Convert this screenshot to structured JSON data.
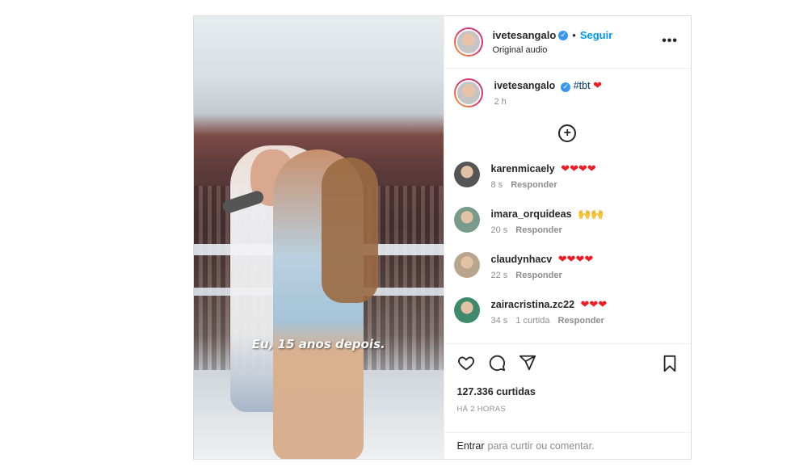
{
  "post": {
    "username": "ivetesangalo",
    "verified_mark": "✓",
    "separator": "•",
    "follow_label": "Seguir",
    "audio_label": "Original audio",
    "more_label": "•••",
    "video_caption": "Eu, 15 anos depois."
  },
  "caption": {
    "username": "ivetesangalo",
    "text": "#tbt",
    "emoji": "❤",
    "time": "2 h"
  },
  "load_more_label": "+",
  "comments": [
    {
      "username": "karenmicaely",
      "text": "❤❤❤❤",
      "time": "8 s",
      "likes": "",
      "reply": "Responder",
      "avatar_color": "#555555"
    },
    {
      "username": "imara_orquideas",
      "text": "🙌🙌",
      "time": "20 s",
      "likes": "",
      "reply": "Responder",
      "avatar_color": "#7a9a8a"
    },
    {
      "username": "claudynhacv",
      "text": "❤❤❤❤",
      "time": "22 s",
      "likes": "",
      "reply": "Responder",
      "avatar_color": "#b9a48e"
    },
    {
      "username": "zairacristina.zc22",
      "text": "❤❤❤",
      "time": "34 s",
      "likes": "1 curtida",
      "reply": "Responder",
      "avatar_color": "#3f8a6a"
    }
  ],
  "actions": {
    "like_icon": "heart-icon",
    "comment_icon": "comment-icon",
    "share_icon": "share-icon",
    "save_icon": "bookmark-icon",
    "likes_count": "127.336 curtidas",
    "posted_ago": "HÁ 2 HORAS"
  },
  "add_comment": {
    "login_label": "Entrar",
    "rest_label": "para curtir ou comentar."
  },
  "colors": {
    "link": "#0095f6",
    "verified": "#3897f0",
    "heart": "#ed1c24",
    "muted": "#8e8e8e"
  }
}
